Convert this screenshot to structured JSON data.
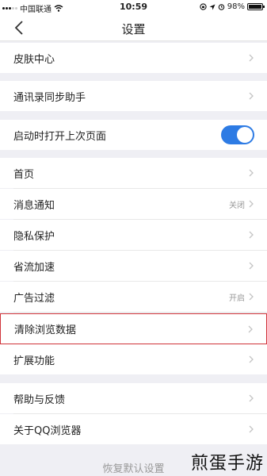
{
  "status": {
    "carrier": "中国联通",
    "time": "10:59",
    "battery_pct": "98%",
    "battery_level": 0.98,
    "signal_icon": "signal-dots-icon",
    "wifi_icon": "wifi-icon",
    "location_icon": "location-arrow-icon",
    "alarm_icon": "alarm-clock-icon",
    "lock_icon": "rotation-lock-icon"
  },
  "nav": {
    "title": "设置",
    "back_icon": "chevron-left-icon"
  },
  "settings": {
    "skin_center": "皮肤中心",
    "contacts_sync": "通讯录同步助手",
    "open_last_page": "启动时打开上次页面",
    "open_last_page_on": true,
    "home": "首页",
    "notifications": "消息通知",
    "notifications_value": "关闭",
    "privacy": "隐私保护",
    "data_saver": "省流加速",
    "ad_filter": "广告过滤",
    "ad_filter_value": "开启",
    "clear_data": "清除浏览数据",
    "extensions": "扩展功能",
    "help_feedback": "帮助与反馈",
    "about": "关于QQ浏览器"
  },
  "restore_defaults": "恢复默认设置",
  "watermark": "煎蛋手游",
  "colors": {
    "accent": "#2d7be4",
    "highlight": "#d0343a",
    "background": "#efeff4"
  }
}
